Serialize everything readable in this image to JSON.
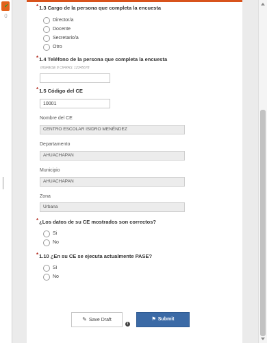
{
  "sidebar": {
    "badge_count": "0",
    "check_icon": "check-icon"
  },
  "colors": {
    "accent": "#d8531c",
    "submit": "#3b6aa6",
    "required": "#b22a1e"
  },
  "q13": {
    "label": "1.3 Cargo de la persona que completa la encuesta",
    "options": [
      "Director/a",
      "Docente",
      "Secretario/a",
      "Otro"
    ]
  },
  "q14": {
    "label": "1.4 Teléfono de la persona que completa la encuesta",
    "hint": "INGRESE 8 CIFRAS: 12345678",
    "value": ""
  },
  "q15": {
    "label": "1.5 Código del CE",
    "value": "10001"
  },
  "ce_name": {
    "label": "Nombre del CE",
    "value": "CENTRO ESCOLAR ISIDRO MENÉNDEZ"
  },
  "department": {
    "label": "Departamento",
    "value": "AHUACHAPAN"
  },
  "municipality": {
    "label": "Municipio",
    "value": "AHUACHAPAN"
  },
  "zone": {
    "label": "Zona",
    "value": "Urbana"
  },
  "q_data": {
    "label": "¿Los datos de su CE mostrados son correctos?",
    "options": [
      "Si",
      "No"
    ]
  },
  "q110": {
    "label": "1.10 ¿En su CE se ejecuta actualmente PASE?",
    "options": [
      "Si",
      "No"
    ]
  },
  "actions": {
    "save_draft": "Save Draft",
    "submit": "Submit"
  }
}
